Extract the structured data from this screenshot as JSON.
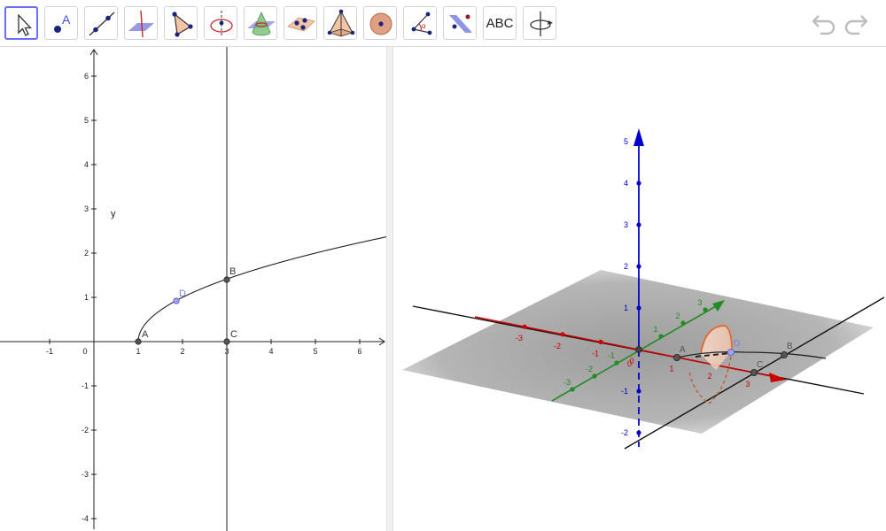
{
  "toolbar": {
    "tools": [
      {
        "name": "move-tool",
        "icon": "cursor-arrow-icon",
        "active": true
      },
      {
        "name": "point-tool",
        "icon": "point-icon",
        "label": "A"
      },
      {
        "name": "line-tool",
        "icon": "line-icon"
      },
      {
        "name": "perpendicular-line-tool",
        "icon": "perpendicular-line-icon"
      },
      {
        "name": "polygon-tool",
        "icon": "polygon-icon"
      },
      {
        "name": "circle-tool",
        "icon": "circle-axis-icon"
      },
      {
        "name": "intersect-curve-tool",
        "icon": "intersect-surfaces-icon"
      },
      {
        "name": "plane-through-points-tool",
        "icon": "plane-points-icon"
      },
      {
        "name": "pyramid-tool",
        "icon": "pyramid-icon"
      },
      {
        "name": "sphere-tool",
        "icon": "sphere-icon"
      },
      {
        "name": "angle-tool",
        "icon": "angle-icon"
      },
      {
        "name": "reflect-tool",
        "icon": "reflect-about-plane-icon"
      },
      {
        "name": "text-tool",
        "icon": "text-icon",
        "label": "ABC"
      },
      {
        "name": "rotate-view-tool",
        "icon": "rotate-view-icon"
      }
    ],
    "undo_icon": "undo-icon",
    "redo_icon": "redo-icon",
    "accent": "#6a6ef0"
  },
  "graphics2d": {
    "x_ticks": [
      "-1",
      "0",
      "1",
      "2",
      "3",
      "4",
      "5",
      "6"
    ],
    "y_ticks": [
      "6",
      "5",
      "4",
      "3",
      "2",
      "1",
      "-1",
      "-2",
      "-3",
      "-4"
    ],
    "y_label": "y",
    "points": {
      "A": "A",
      "B": "B",
      "C": "C",
      "D": "D"
    },
    "curve_color": "#000000",
    "point_color": "#444444",
    "free_point_color": "#7b7fe0"
  },
  "graphics3d": {
    "z_ticks": [
      "5",
      "4",
      "3",
      "2",
      "1",
      "-1",
      "-2"
    ],
    "x_ticks": [
      "-3",
      "-2",
      "-1",
      "0",
      "1",
      "2",
      "3"
    ],
    "y_ticks": [
      "-3",
      "-2",
      "-1",
      "1",
      "2",
      "3"
    ],
    "origin_label": "0",
    "points": {
      "A": "A",
      "B": "B",
      "C": "C",
      "D": "D"
    },
    "x_axis_color": "#cc0000",
    "y_axis_color": "#228b22",
    "z_axis_color": "#0000cc",
    "surface_color": "#e07040"
  }
}
